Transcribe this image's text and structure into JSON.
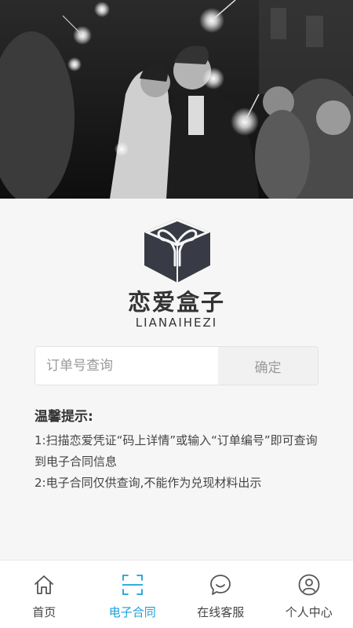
{
  "brand": {
    "name_cn": "恋爱盒子",
    "name_en": "LIANAIHEZI"
  },
  "search": {
    "placeholder": "订单号查询",
    "value": "",
    "confirm_label": "确定"
  },
  "tips": {
    "title": "温馨提示:",
    "line1": "1:扫描恋爱凭证“码上详情”或输入“订单编号”即可查询到电子合同信息",
    "line2": "2:电子合同仅供查询,不能作为兑现材料出示"
  },
  "tabbar": {
    "active_color": "#1a9fd8",
    "items": [
      {
        "label": "首页",
        "icon": "home-icon"
      },
      {
        "label": "电子合同",
        "icon": "scan-icon",
        "active": true
      },
      {
        "label": "在线客服",
        "icon": "chat-icon"
      },
      {
        "label": "个人中心",
        "icon": "user-icon"
      }
    ]
  }
}
